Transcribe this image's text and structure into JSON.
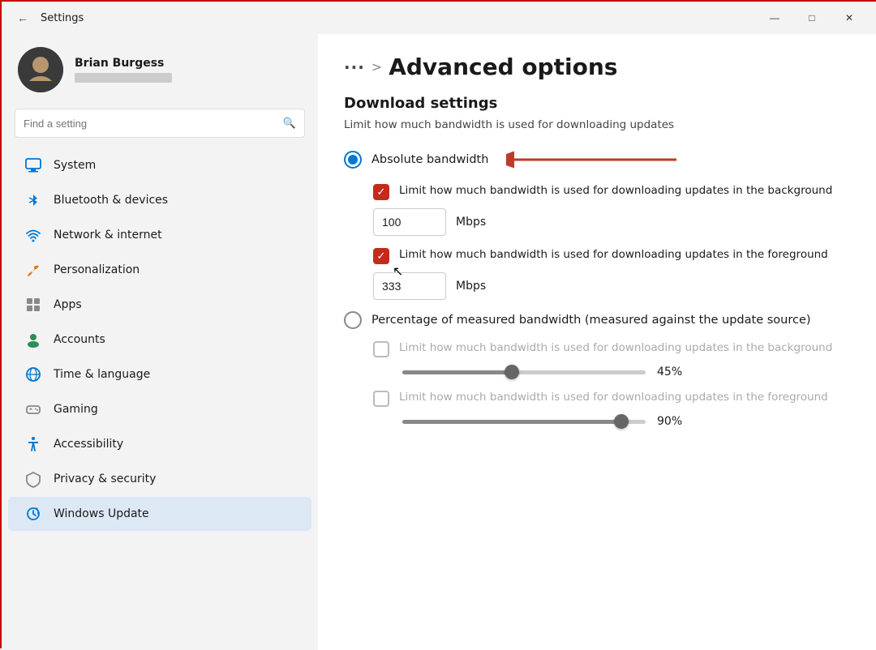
{
  "window": {
    "title": "Settings",
    "back_button": "←"
  },
  "titlebar_controls": {
    "minimize": "—",
    "maximize": "□",
    "close": "✕"
  },
  "user": {
    "name": "Brian Burgess"
  },
  "search": {
    "placeholder": "Find a setting"
  },
  "nav": {
    "items": [
      {
        "id": "system",
        "label": "System",
        "icon": "monitor"
      },
      {
        "id": "bluetooth",
        "label": "Bluetooth & devices",
        "icon": "bluetooth"
      },
      {
        "id": "network",
        "label": "Network & internet",
        "icon": "wifi"
      },
      {
        "id": "personalization",
        "label": "Personalization",
        "icon": "brush"
      },
      {
        "id": "apps",
        "label": "Apps",
        "icon": "apps"
      },
      {
        "id": "accounts",
        "label": "Accounts",
        "icon": "person"
      },
      {
        "id": "time",
        "label": "Time & language",
        "icon": "globe"
      },
      {
        "id": "gaming",
        "label": "Gaming",
        "icon": "gaming"
      },
      {
        "id": "accessibility",
        "label": "Accessibility",
        "icon": "accessibility"
      },
      {
        "id": "privacy",
        "label": "Privacy & security",
        "icon": "shield"
      },
      {
        "id": "update",
        "label": "Windows Update",
        "icon": "update"
      }
    ]
  },
  "breadcrumb": {
    "dots": "···",
    "separator": ">",
    "page": "Advanced options"
  },
  "main": {
    "section_title": "Download settings",
    "section_desc": "Limit how much bandwidth is used for downloading updates",
    "radio1": {
      "label": "Absolute bandwidth",
      "selected": true
    },
    "checkbox1": {
      "label": "Limit how much bandwidth is used for downloading updates in the background",
      "checked": true
    },
    "input1": {
      "value": "100",
      "unit": "Mbps"
    },
    "checkbox2": {
      "label": "Limit how much bandwidth is used for downloading updates in the foreground",
      "checked": true
    },
    "input2": {
      "value": "333",
      "unit": "Mbps"
    },
    "radio2": {
      "label": "Percentage of measured bandwidth (measured against the update source)",
      "selected": false
    },
    "checkbox3": {
      "label": "Limit how much bandwidth is used for downloading updates in the background",
      "checked": false,
      "disabled": true
    },
    "slider1": {
      "value": 45,
      "display": "45%"
    },
    "checkbox4": {
      "label": "Limit how much bandwidth is used for downloading updates in the foreground",
      "checked": false,
      "disabled": true
    },
    "slider2": {
      "value": 90,
      "display": "90%"
    }
  }
}
